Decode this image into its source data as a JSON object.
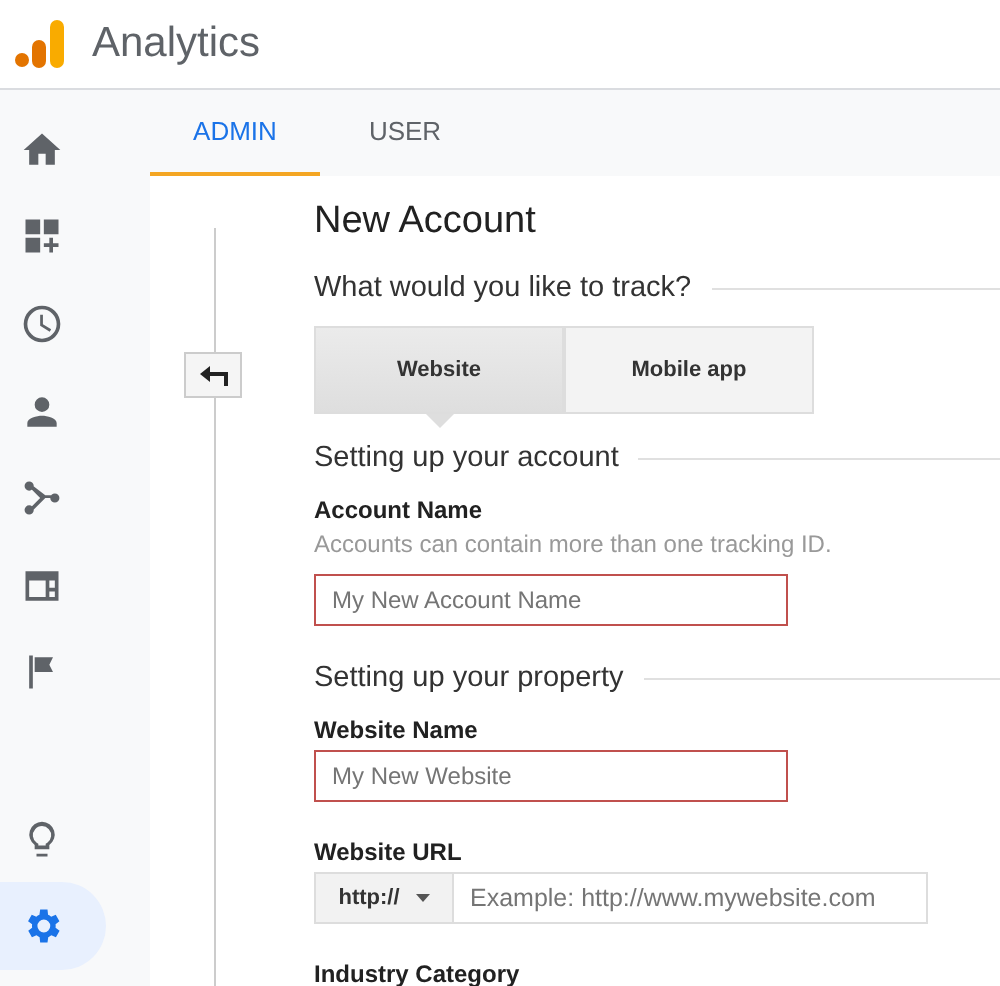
{
  "app": {
    "title": "Analytics"
  },
  "nav": [
    {
      "kind": "home",
      "selected": false
    },
    {
      "kind": "dashboard",
      "selected": false
    },
    {
      "kind": "clock",
      "selected": false
    },
    {
      "kind": "person",
      "selected": false
    },
    {
      "kind": "branch",
      "selected": false
    },
    {
      "kind": "layout",
      "selected": false
    },
    {
      "kind": "flag",
      "selected": false
    },
    {
      "kind": "bulb",
      "selected": false
    },
    {
      "kind": "gear",
      "selected": true
    }
  ],
  "tabs": [
    {
      "label": "ADMIN",
      "selected": true
    },
    {
      "label": "USER",
      "selected": false
    }
  ],
  "page": {
    "title": "New Account",
    "track": {
      "heading": "What would you like to track?",
      "options": [
        {
          "label": "Website",
          "selected": true
        },
        {
          "label": "Mobile app",
          "selected": false
        }
      ]
    },
    "sections": [
      {
        "heading": "Setting up your account",
        "fields": [
          {
            "kind": "text",
            "label": "Account Name",
            "hint": "Accounts can contain more than one tracking ID.",
            "placeholder": "My New Account Name",
            "error": true
          }
        ]
      },
      {
        "heading": "Setting up your property",
        "fields": [
          {
            "kind": "text",
            "label": "Website Name",
            "placeholder": "My New Website",
            "error": true
          },
          {
            "kind": "url",
            "label": "Website URL",
            "protocol": "http://",
            "placeholder": "Example: http://www.mywebsite.com",
            "error": false
          },
          {
            "kind": "cut",
            "label": "Industry Category"
          }
        ]
      }
    ]
  }
}
